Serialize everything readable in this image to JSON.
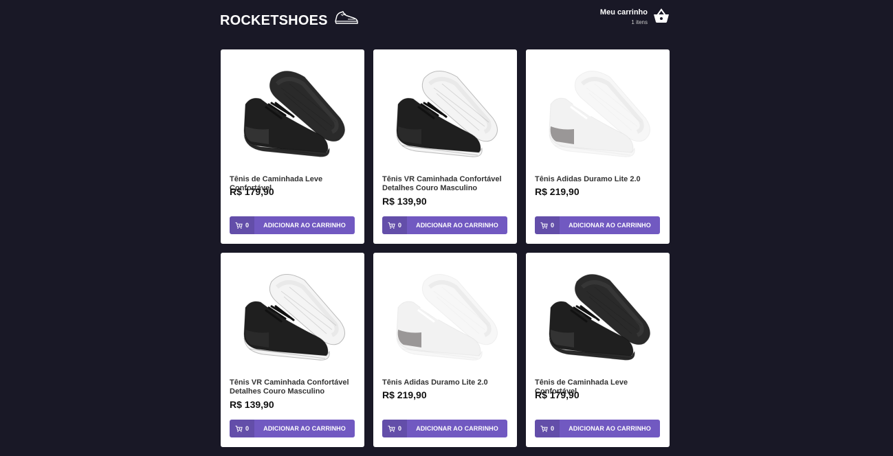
{
  "header": {
    "logo_text": "ROCKETSHOES",
    "logo_icon": "sneaker-icon",
    "cart_title": "Meu carrinho",
    "cart_count": "1 itens",
    "cart_icon": "basket-icon"
  },
  "colors": {
    "background": "#191826",
    "accent": "#7159c1",
    "card": "#ffffff"
  },
  "products": [
    {
      "name": "Tênis de Caminhada Leve Confortável",
      "price": "R$ 179,90",
      "amount": "0",
      "button": "ADICIONAR AO CARRINHO",
      "image": "black-sneaker"
    },
    {
      "name": "Tênis VR Caminhada Confortável Detalhes Couro Masculino",
      "price": "R$ 139,90",
      "amount": "0",
      "button": "ADICIONAR AO CARRINHO",
      "image": "black-white-sneaker"
    },
    {
      "name": "Tênis Adidas Duramo Lite 2.0",
      "price": "R$ 219,90",
      "amount": "0",
      "button": "ADICIONAR AO CARRINHO",
      "image": "white-grey-sneaker"
    },
    {
      "name": "Tênis VR Caminhada Confortável Detalhes Couro Masculino",
      "price": "R$ 139,90",
      "amount": "0",
      "button": "ADICIONAR AO CARRINHO",
      "image": "black-white-sneaker"
    },
    {
      "name": "Tênis Adidas Duramo Lite 2.0",
      "price": "R$ 219,90",
      "amount": "0",
      "button": "ADICIONAR AO CARRINHO",
      "image": "white-grey-sneaker"
    },
    {
      "name": "Tênis de Caminhada Leve Confortável",
      "price": "R$ 179,90",
      "amount": "0",
      "button": "ADICIONAR AO CARRINHO",
      "image": "black-sneaker"
    }
  ]
}
